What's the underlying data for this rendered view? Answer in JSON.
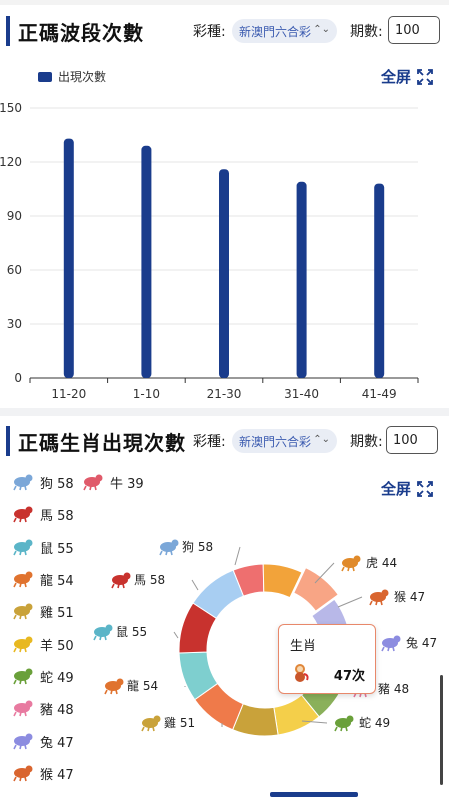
{
  "section1": {
    "title": "正碼波段次數",
    "lottery_label": "彩種:",
    "lottery_value": "新澳門六合彩",
    "period_label": "期數:",
    "period_value": "100",
    "legend_label": "出現次數",
    "fullscreen_label": "全屏"
  },
  "chart_data": {
    "type": "bar",
    "categories": [
      "11-20",
      "1-10",
      "21-30",
      "31-40",
      "41-49"
    ],
    "values": [
      133,
      129,
      116,
      109,
      108
    ],
    "series_name": "出現次數",
    "ylim": [
      0,
      150
    ],
    "yticks": [
      "0",
      "30",
      "60",
      "90",
      "120",
      "150"
    ],
    "color": "#1a3c8c",
    "grid": true
  },
  "section2": {
    "title": "正碼生肖出現次數",
    "lottery_label": "彩種:",
    "lottery_value": "新澳門六合彩",
    "period_label": "期數:",
    "period_value": "100",
    "fullscreen_label": "全屏",
    "legend": [
      {
        "name": "狗",
        "value": "58",
        "icon": "dog-icon"
      },
      {
        "name": "牛",
        "value": "39",
        "icon": "ox-icon"
      },
      {
        "name": "馬",
        "value": "58",
        "icon": "horse-icon"
      },
      {
        "name": "鼠",
        "value": "55",
        "icon": "rat-icon"
      },
      {
        "name": "龍",
        "value": "54",
        "icon": "dragon-icon"
      },
      {
        "name": "雞",
        "value": "51",
        "icon": "rooster-icon"
      },
      {
        "name": "羊",
        "value": "50",
        "icon": "goat-icon"
      },
      {
        "name": "蛇",
        "value": "49",
        "icon": "snake-icon"
      },
      {
        "name": "豬",
        "value": "48",
        "icon": "pig-icon"
      },
      {
        "name": "兔",
        "value": "47",
        "icon": "rabbit-icon"
      },
      {
        "name": "猴",
        "value": "47",
        "icon": "monkey-icon"
      }
    ],
    "donut_labels": [
      {
        "name": "虎",
        "value": "44"
      },
      {
        "name": "猴",
        "value": "47"
      },
      {
        "name": "兔",
        "value": "47"
      },
      {
        "name": "豬",
        "value": "48"
      },
      {
        "name": "蛇",
        "value": "49"
      },
      {
        "name": "雞",
        "value": "51"
      },
      {
        "name": "龍",
        "value": "54"
      },
      {
        "name": "鼠",
        "value": "55"
      },
      {
        "name": "馬",
        "value": "58"
      },
      {
        "name": "狗",
        "value": "58"
      }
    ],
    "tooltip_title": "生肖",
    "tooltip_value": "47次",
    "slice_colors": [
      "#ee6f6f",
      "#f2a33a",
      "#f8a585",
      "#b8b8e8",
      "#6aa0d8",
      "#8ab05a",
      "#f4cf4a",
      "#c9a23a",
      "#ef7a4a",
      "#7ecfcf",
      "#c8322e",
      "#a8cef2"
    ]
  }
}
